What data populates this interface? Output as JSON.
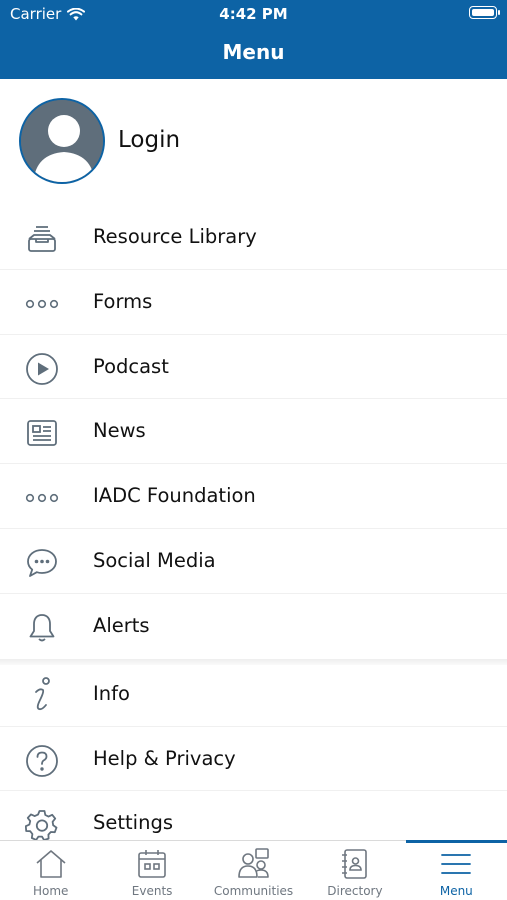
{
  "status_bar": {
    "carrier": "Carrier",
    "time": "4:42 PM"
  },
  "nav": {
    "title": "Menu"
  },
  "profile": {
    "login_label": "Login"
  },
  "menu": {
    "items": [
      {
        "label": "Resource Library",
        "icon": "inbox-tray-icon"
      },
      {
        "label": "Forms",
        "icon": "more-dots-icon"
      },
      {
        "label": "Podcast",
        "icon": "play-circle-icon"
      },
      {
        "label": "News",
        "icon": "newspaper-icon"
      },
      {
        "label": "IADC Foundation",
        "icon": "more-dots-icon"
      },
      {
        "label": "Social Media",
        "icon": "chat-bubble-icon"
      },
      {
        "label": "Alerts",
        "icon": "bell-icon"
      },
      {
        "label": "Info",
        "icon": "info-icon"
      },
      {
        "label": "Help & Privacy",
        "icon": "help-circle-icon"
      },
      {
        "label": "Settings",
        "icon": "gear-icon"
      }
    ]
  },
  "tabs": [
    {
      "label": "Home",
      "icon": "home-icon"
    },
    {
      "label": "Events",
      "icon": "calendar-icon"
    },
    {
      "label": "Communities",
      "icon": "communities-icon"
    },
    {
      "label": "Directory",
      "icon": "address-book-icon"
    },
    {
      "label": "Menu",
      "icon": "hamburger-menu-icon",
      "active": true
    }
  ],
  "colors": {
    "brand": "#0d63a5",
    "icon_gray": "#5f6e7b",
    "tab_inactive": "#6f7780"
  }
}
